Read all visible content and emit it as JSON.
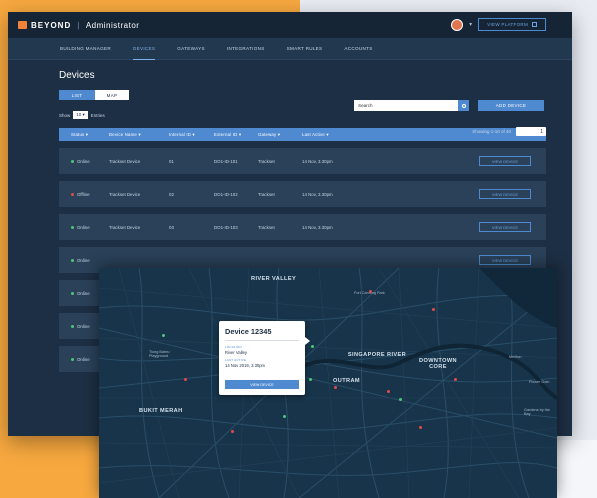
{
  "app": {
    "brand": "BEYOND",
    "section": "Administrator",
    "view_platform": "VIEW PLATFORM"
  },
  "nav": [
    "BUILDING MANAGER",
    "DEVICES",
    "GATEWAYS",
    "INTEGRATIONS",
    "SMART RULES",
    "ACCOUNTS"
  ],
  "page": {
    "title": "Devices",
    "toggle_list": "LIST",
    "toggle_map": "MAP",
    "search_placeholder": "Search",
    "add_device": "ADD DEVICE",
    "show_label": "Show",
    "show_value": "10",
    "entries_label": "Entries",
    "showing": "Showing 1-10 of 40",
    "pager": "1"
  },
  "table": {
    "headers": [
      "Status",
      "Device Name",
      "Internal ID",
      "External ID",
      "Gateway",
      "Last Active"
    ],
    "rows": [
      {
        "status": "Online",
        "name": "Trackset Device",
        "iid": "01",
        "eid": "DO1-ID-101",
        "gw": "Trackset",
        "last": "14 Nov, 3.30pm"
      },
      {
        "status": "Offline",
        "name": "Trackset Device",
        "iid": "02",
        "eid": "DO1-ID-102",
        "gw": "Trackset",
        "last": "14 Nov, 3.30pm"
      },
      {
        "status": "Online",
        "name": "Trackset Device",
        "iid": "03",
        "eid": "DO1-ID-103",
        "gw": "Trackset",
        "last": "14 Nov, 3.30pm"
      },
      {
        "status": "Online"
      },
      {
        "status": "Online"
      },
      {
        "status": "Online"
      },
      {
        "status": "Online"
      }
    ],
    "view_btn": "VIEW DEVICE"
  },
  "map": {
    "labels": {
      "river_valley": "RIVER VALLEY",
      "fort_canning": "Fort Canning Park",
      "singapore_river": "SINGAPORE RIVER",
      "downtown": "DOWNTOWN CORE",
      "outram": "OUTRAM",
      "bukit_merah": "BUKIT MERAH",
      "tiong": "Tiong Bahru Playground",
      "merlion": "Merlion",
      "gardens": "Gardens by the Bay",
      "flower": "Flower Dom"
    },
    "popup": {
      "title": "Device 12345",
      "loc_label": "LOCATION",
      "loc_value": "River Valley",
      "last_label": "LAST ACTIVE",
      "last_value": "14 Nov 2019, 3.30pm",
      "button": "VIEW DEVICE"
    }
  },
  "colors": {
    "accent": "#4f8ad0",
    "online": "#4cc777",
    "offline": "#e34a4a",
    "brand": "#f0823a"
  }
}
